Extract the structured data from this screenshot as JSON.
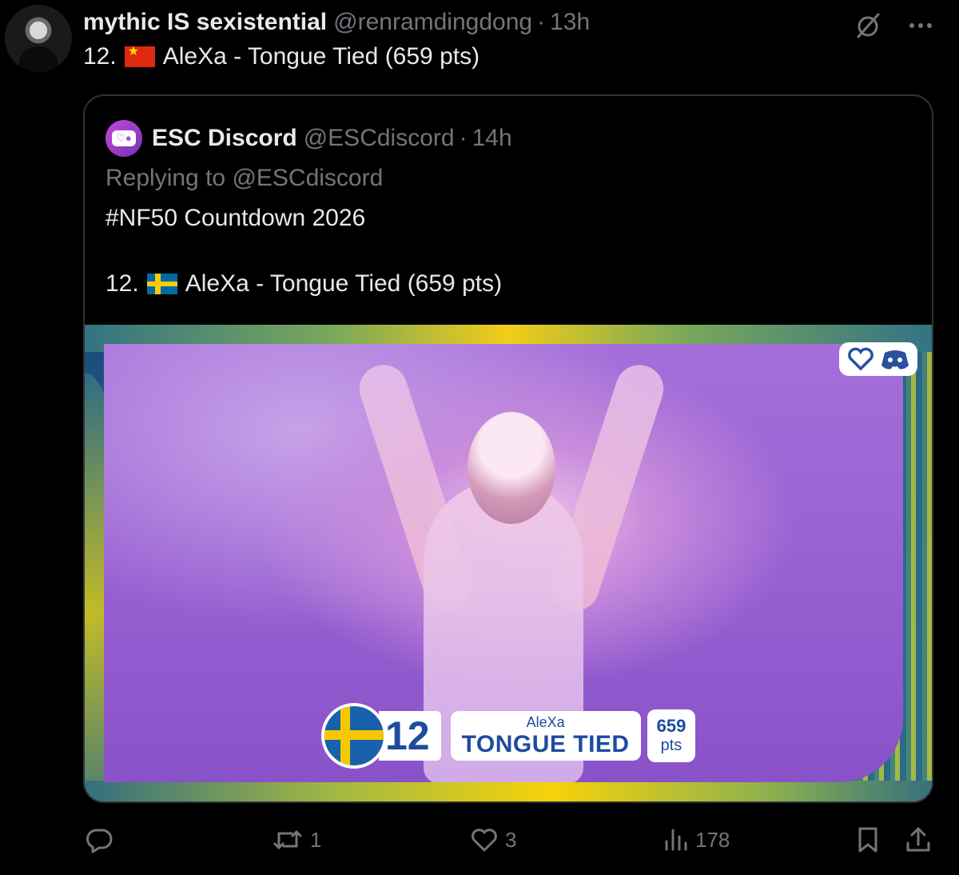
{
  "post": {
    "author_name": "mythic IS sexistential",
    "author_handle": "@renramdingdong",
    "separator": "·",
    "time": "13h",
    "text_number": "12.",
    "text_body": "AleXa - Tongue Tied (659 pts)"
  },
  "quoted": {
    "author_name": "ESC Discord",
    "author_handle": "@ESCdiscord",
    "separator": "·",
    "time": "14h",
    "replying_prefix": "Replying to",
    "replying_mention": "@ESCdiscord",
    "line1": "#NF50 Countdown 2026",
    "line2_number": "12.",
    "line2_body": "AleXa - Tongue Tied (659 pts)"
  },
  "media": {
    "rank": "12",
    "artist": "AleXa",
    "song": "TONGUE TIED",
    "points_value": "659",
    "points_unit": "pts"
  },
  "actions": {
    "reposts": "1",
    "likes": "3",
    "views": "178"
  },
  "colors": {
    "background": "#000000",
    "text_primary": "#e7e9ea",
    "text_secondary": "#71767b",
    "border": "#2f3336",
    "sweden_blue": "#006aa7",
    "sweden_yellow": "#fecc00",
    "china_red": "#de2910"
  },
  "icons": [
    "grok-icon",
    "more-icon",
    "reply-icon",
    "repost-icon",
    "like-icon",
    "views-icon",
    "bookmark-icon",
    "share-icon"
  ]
}
